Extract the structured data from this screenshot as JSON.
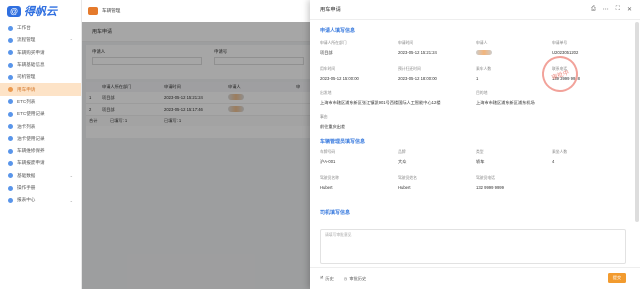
{
  "app": {
    "logo_mark": "@",
    "logo_text": "得帆云",
    "tab": "车辆管理"
  },
  "sidebar": {
    "items": [
      {
        "label": "工作台"
      },
      {
        "label": "流程管理",
        "chev": "⌃"
      },
      {
        "label": "车辆购买申请",
        "sub": true
      },
      {
        "label": "车辆基础信息",
        "sub": true
      },
      {
        "label": "司机管理",
        "sub": true
      },
      {
        "label": "用车申请",
        "sub": true,
        "active": true
      },
      {
        "label": "ETC列表"
      },
      {
        "label": "ETC使用记录"
      },
      {
        "label": "油卡列表"
      },
      {
        "label": "油卡使用记录"
      },
      {
        "label": "车辆维修保养"
      },
      {
        "label": "车辆报废申请"
      },
      {
        "label": "基础数据",
        "chev": "⌄"
      },
      {
        "label": "操作手册"
      },
      {
        "label": "报表中心",
        "chev": "⌄"
      }
    ]
  },
  "main": {
    "page_title": "用车申请",
    "filter": {
      "applicant_label": "申请人",
      "order_label": "申请号"
    },
    "table": {
      "headers": [
        "",
        "申请人所在部门",
        "申请时间",
        "申请人",
        "申"
      ],
      "rows": [
        {
          "idx": "1",
          "dept": "项目部",
          "time": "2023-05-12 15:21:24"
        },
        {
          "idx": "2",
          "dept": "项目部",
          "time": "2023-05-12 15:17:46"
        }
      ],
      "footer": {
        "label": "合计",
        "f1": "已填写: 1",
        "f2": "已填写: 1"
      }
    }
  },
  "drawer": {
    "title": "用车申请",
    "stamp": "审批中",
    "s1": "申请人填写信息",
    "s2": "车辆管理员填写信息",
    "s3": "司机填写信息",
    "fields1": [
      {
        "l": "申请人所在部门",
        "v": "项目部"
      },
      {
        "l": "申请时间",
        "v": "2023-05-12 15:21:24"
      },
      {
        "l": "申请人",
        "v": ""
      },
      {
        "l": "申请单号",
        "v": "U2023051202"
      },
      {
        "l": "用车时间",
        "v": "2023-05-12 15:00:00"
      },
      {
        "l": "预计归还时间",
        "v": "2023-05-12 18:00:00"
      },
      {
        "l": "乘车人数",
        "v": "1"
      },
      {
        "l": "联系电话",
        "v": "139 3999 9998"
      },
      {
        "l": "出发地",
        "v": "上海市市辖区浦东新区张江镇凯901号西楼国际人工智能中心12楼"
      },
      {
        "l": "目的地",
        "v": "上海市市辖区浦东新区浦东机场"
      },
      {
        "l": "事由",
        "v": "前往重庆出差"
      }
    ],
    "fields2": [
      {
        "l": "车牌号码",
        "v": "沪A-001"
      },
      {
        "l": "品牌",
        "v": "大众"
      },
      {
        "l": "类型",
        "v": "轿车"
      },
      {
        "l": "乘坐人数",
        "v": "4"
      },
      {
        "l": "驾驶员名称",
        "v": "Hubert"
      },
      {
        "l": "驾驶员姓名",
        "v": "Hubert"
      },
      {
        "l": "驾驶员电话",
        "v": "132 9999 9999"
      }
    ],
    "remark_placeholder": "请填写审批意见",
    "footer": {
      "history": "历史",
      "process": "审批历史",
      "submit": "提交"
    }
  }
}
